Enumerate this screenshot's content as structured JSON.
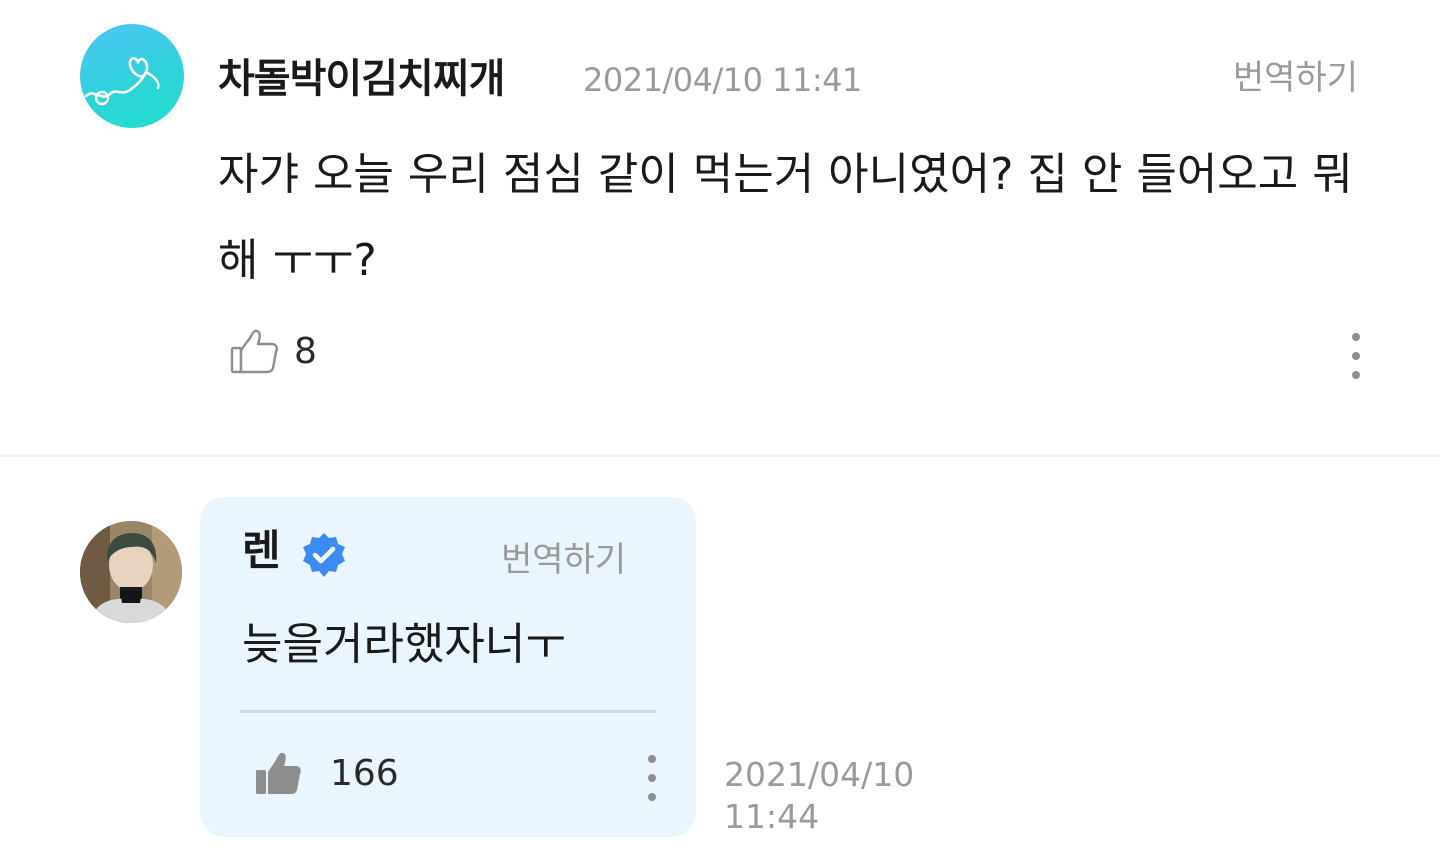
{
  "comment1": {
    "author": "차돌박이김치찌개",
    "timestamp": "2021/04/10 11:41",
    "translate_label": "번역하기",
    "text": "자갸 오늘 우리 점심 같이 먹는거 아니였어? 집 안 들어오고 뭐해 ㅜㅜ?",
    "like_count": "8",
    "like_icon": "thumbs-up-outline-icon",
    "more_icon": "more-vertical-icon",
    "avatar_icon": "heart-line-icon"
  },
  "comment2": {
    "author": "렌",
    "verified_icon": "verified-badge-icon",
    "translate_label": "번역하기",
    "text": "늦을거라했자너ㅜ",
    "like_count": "166",
    "like_icon": "thumbs-up-filled-icon",
    "more_icon": "more-vertical-icon",
    "timestamp_date": "2021/04/10",
    "timestamp_time": "11:44"
  },
  "colors": {
    "bubble_background": "#e9f6fe",
    "verified_blue": "#3d8bf2",
    "muted_text": "#9a9a9a",
    "avatar_gradient_start": "#4fc3f7",
    "avatar_gradient_end": "#22e0cf"
  }
}
